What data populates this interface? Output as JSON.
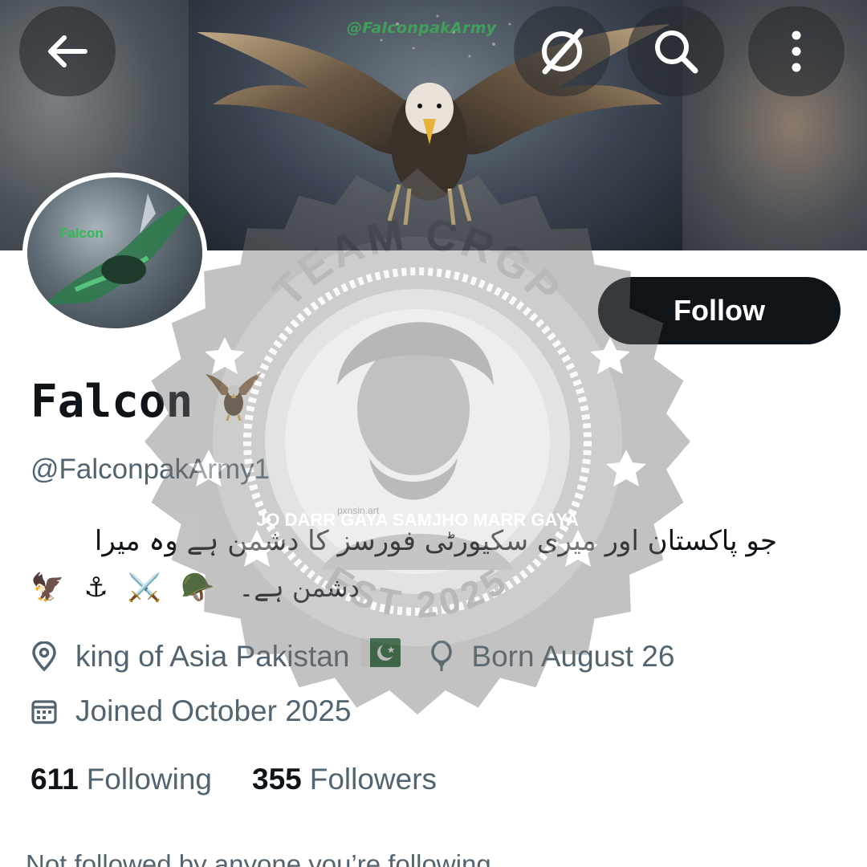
{
  "banner": {
    "watermark_text": "@FalconpakArmy"
  },
  "topbar": {
    "back_icon": "arrow-left-icon",
    "grok_icon": "grok-icon",
    "search_icon": "search-icon",
    "more_icon": "more-vertical-icon"
  },
  "avatar": {
    "label": "Falcon"
  },
  "follow_button": {
    "label": "Follow"
  },
  "profile": {
    "display_name": "Falcon",
    "name_emoji": "🦅",
    "handle": "@FalconpakArmy1",
    "bio_line1": "جو پاکستان اور میری سکیورٹی فورسز کا دشمن ہے وہ میرا",
    "bio_emojis": [
      "🦅",
      "⚓",
      "⚔️",
      "🪖"
    ],
    "bio_line2": "دشمن ہے۔",
    "location": "king of Asia Pakistan",
    "location_flag": "🇵🇰",
    "birthday": "Born August 26",
    "joined": "Joined October 2025"
  },
  "stats": {
    "following_count": "611",
    "following_label": "Following",
    "followers_count": "355",
    "followers_label": "Followers"
  },
  "footer": {
    "not_followed_text": "Not followed by anyone you’re following"
  },
  "overlay_stamp": {
    "top_text": "TEAM CRGP",
    "bottom_text": "EST 2025",
    "center_text": "JO DARR GAYA SAMJHO MARR GAYA",
    "credit": "pxnsin.art"
  },
  "colors": {
    "text_primary": "#0f1419",
    "text_secondary": "#536471",
    "follow_bg": "#0f1419",
    "banner_accent": "#3fa05a"
  }
}
